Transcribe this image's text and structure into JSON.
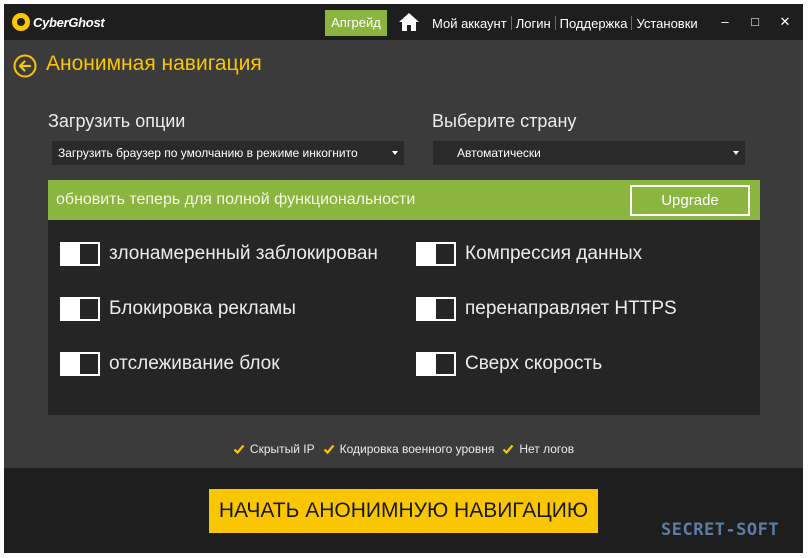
{
  "titlebar": {
    "logo_text": "CyberGhost",
    "upgrade_label": "Апгрейд",
    "nav": [
      "Мой аккаунт",
      "Логин",
      "Поддержка",
      "Установки"
    ],
    "minimize": "–",
    "maximize": "□",
    "close": "✕"
  },
  "header": {
    "title": "Анонимная навигация"
  },
  "load_options": {
    "label": "Загрузить опции",
    "selected": "Загрузить браузер по умолчанию в режиме инкогнито"
  },
  "country": {
    "label": "Выберите страну",
    "selected": "Автоматически"
  },
  "banner": {
    "text": "обновить теперь для полной функциональности",
    "button": "Upgrade"
  },
  "options": [
    {
      "label": "злонамеренный заблокирован",
      "enabled": false
    },
    {
      "label": "Компрессия данных",
      "enabled": false
    },
    {
      "label": "Блокировка рекламы",
      "enabled": false
    },
    {
      "label": "перенаправляет HTTPS",
      "enabled": false
    },
    {
      "label": "отслеживание блок",
      "enabled": false
    },
    {
      "label": "Сверх скорость",
      "enabled": false
    }
  ],
  "features": [
    "Скрытый IP",
    "Кодировка военного уровня",
    "Нет логов"
  ],
  "start_button": "НАЧАТЬ АНОНИМНУЮ НАВИГАЦИЮ",
  "watermark": "SECRET-SOFT",
  "colors": {
    "accent": "#f9c600",
    "green": "#8ab53e",
    "background": "#3b3b3b",
    "titlebar": "#1e1e1e"
  }
}
